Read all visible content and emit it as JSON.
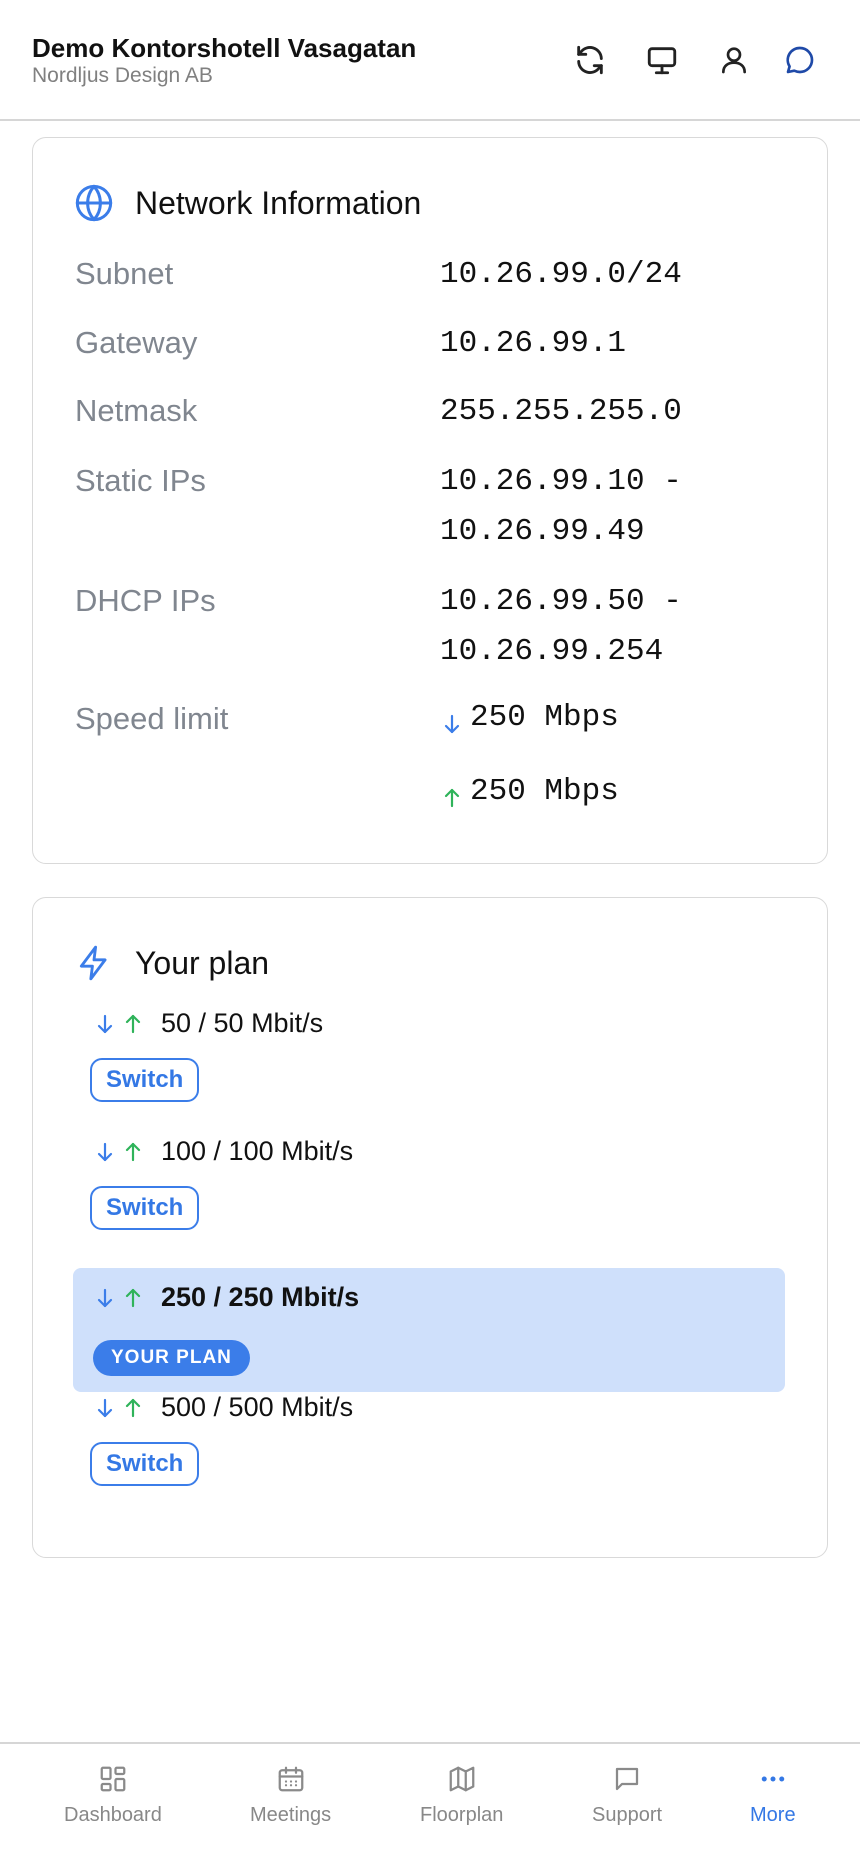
{
  "header": {
    "title": "Demo Kontorshotell Vasagatan",
    "subtitle": "Nordljus Design AB",
    "icons": [
      "refresh-icon",
      "monitor-icon",
      "user-icon",
      "chat-icon"
    ]
  },
  "network": {
    "title": "Network Information",
    "icon": "globe-icon",
    "rows": [
      {
        "label": "Subnet",
        "value": "10.26.99.0/24"
      },
      {
        "label": "Gateway",
        "value": "10.26.99.1"
      },
      {
        "label": "Netmask",
        "value": "255.255.255.0"
      },
      {
        "label": "Static IPs",
        "value_line1": "10.26.99.10 -",
        "value_line2": "10.26.99.49"
      },
      {
        "label": "DHCP IPs",
        "value_line1": "10.26.99.50 -",
        "value_line2": "10.26.99.254"
      }
    ],
    "speed": {
      "label": "Speed limit",
      "down": "250 Mbps",
      "up": "250 Mbps"
    }
  },
  "plan": {
    "title": "Your plan",
    "icon": "lightning-icon",
    "options": [
      {
        "speed": "50 / 50 Mbit/s",
        "action": "Switch"
      },
      {
        "speed": "100 / 100 Mbit/s",
        "action": "Switch"
      },
      {
        "speed": "250 / 250 Mbit/s",
        "badge": "YOUR PLAN"
      },
      {
        "speed": "500 / 500 Mbit/s",
        "action": "Switch"
      }
    ]
  },
  "nav": {
    "items": [
      {
        "label": "Dashboard",
        "icon": "dashboard-icon"
      },
      {
        "label": "Meetings",
        "icon": "calendar-icon"
      },
      {
        "label": "Floorplan",
        "icon": "map-icon"
      },
      {
        "label": "Support",
        "icon": "chat-icon"
      },
      {
        "label": "More",
        "icon": "more-icon"
      }
    ],
    "active": "More"
  },
  "colors": {
    "accent": "#3b7de9",
    "down_arrow": "#3b7de9",
    "up_arrow": "#2fb35a",
    "active_plan_bg": "#cfe0fb",
    "muted_label": "#80868f"
  }
}
